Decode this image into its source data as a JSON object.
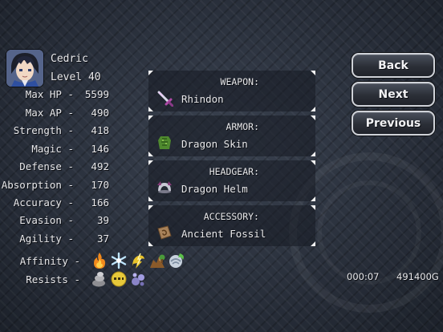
{
  "character": {
    "name": "Cedric",
    "level_text": "Level 40",
    "portrait_icon": "hero-portrait"
  },
  "stats": [
    {
      "label": "Max HP -",
      "value": "5599"
    },
    {
      "label": "Max AP -",
      "value": "490"
    },
    {
      "label": "Strength -",
      "value": "418"
    },
    {
      "label": "Magic -",
      "value": "146"
    },
    {
      "label": "Defense -",
      "value": "492"
    },
    {
      "label": "Absorption -",
      "value": "170"
    },
    {
      "label": "Accuracy -",
      "value": "166"
    },
    {
      "label": "Evasion -",
      "value": "39"
    },
    {
      "label": "Agility -",
      "value": "37"
    }
  ],
  "affinity": {
    "label": "Affinity -",
    "icons": [
      "fire-element-icon",
      "ice-element-icon",
      "lightning-element-icon",
      "earth-element-icon",
      "wind-element-icon"
    ]
  },
  "resists": {
    "label": "Resists -",
    "icons": [
      "stone-status-icon",
      "blind-status-icon",
      "poison-status-icon"
    ]
  },
  "equipment": [
    {
      "slot": "WEAPON:",
      "item": "Rhindon",
      "icon": "sword-icon"
    },
    {
      "slot": "ARMOR:",
      "item": "Dragon Skin",
      "icon": "dragon-skin-icon"
    },
    {
      "slot": "HEADGEAR:",
      "item": "Dragon Helm",
      "icon": "helm-icon"
    },
    {
      "slot": "ACCESSORY:",
      "item": "Ancient Fossil",
      "icon": "fossil-icon"
    }
  ],
  "buttons": {
    "back": "Back",
    "next": "Next",
    "previous": "Previous"
  },
  "status": {
    "playtime": "000:07",
    "gold": "491400G"
  },
  "colors": {
    "background": "#262c38",
    "text": "#e8e8ea",
    "button_border": "#cfd2d8"
  }
}
